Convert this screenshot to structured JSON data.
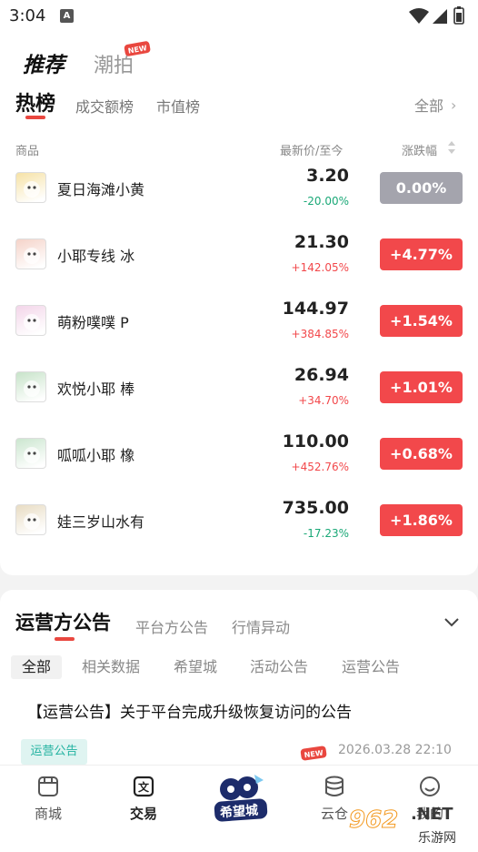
{
  "status_bar": {
    "time": "3:04",
    "notification_icon": "A"
  },
  "top_tabs": {
    "recommend": "推荐",
    "trend": "潮拍",
    "new_badge": "NEW"
  },
  "sub_tabs": {
    "hot": "热榜",
    "volume": "成交额榜",
    "market_cap": "市值榜",
    "all": "全部",
    "all_chevron": "›"
  },
  "columns": {
    "goods": "商品",
    "price": "最新价/至今",
    "change": "涨跌幅"
  },
  "colors": {
    "up": "#f2484b",
    "down": "#1aa877",
    "flat": "#a4a4ad",
    "accent": "#e9473f"
  },
  "rows": [
    {
      "name": "夏日海滩小黄",
      "price": "3.20",
      "rel": "-20.00%",
      "rel_dir": "down",
      "change": "0.00%",
      "change_dir": "flat",
      "thumb_color": "#f6e2a6"
    },
    {
      "name": "小耶专线 冰",
      "price": "21.30",
      "rel": "+142.05%",
      "rel_dir": "up",
      "change": "+4.77%",
      "change_dir": "up",
      "thumb_color": "#f5d3c9"
    },
    {
      "name": "萌粉噗噗 P",
      "price": "144.97",
      "rel": "+384.85%",
      "rel_dir": "up",
      "change": "+1.54%",
      "change_dir": "up",
      "thumb_color": "#f3d5e9"
    },
    {
      "name": "欢悦小耶 棒",
      "price": "26.94",
      "rel": "+34.70%",
      "rel_dir": "up",
      "change": "+1.01%",
      "change_dir": "up",
      "thumb_color": "#c7e3c9"
    },
    {
      "name": "呱呱小耶 橡",
      "price": "110.00",
      "rel": "+452.76%",
      "rel_dir": "up",
      "change": "+0.68%",
      "change_dir": "up",
      "thumb_color": "#cbe6cf"
    },
    {
      "name": "娃三岁山水有",
      "price": "735.00",
      "rel": "-17.23%",
      "rel_dir": "down",
      "change": "+1.86%",
      "change_dir": "up",
      "thumb_color": "#e8dcc3"
    }
  ],
  "announcements": {
    "title": "运营方公告",
    "tab_platform": "平台方公告",
    "tab_market": "行情异动",
    "filters": [
      "全部",
      "相关数据",
      "希望城",
      "活动公告",
      "运营公告"
    ],
    "headline": "【运营公告】关于平台完成升级恢复访问的公告",
    "tag": "运营公告",
    "new_badge": "NEW",
    "date": "2026.03.28 22:10"
  },
  "bottom_nav": {
    "items": [
      {
        "label": "商城",
        "icon": "shop-icon"
      },
      {
        "label": "交易",
        "icon": "trade-icon",
        "active": true
      },
      {
        "label": "希望城",
        "icon": "hope-city-logo"
      },
      {
        "label": "云仓",
        "icon": "warehouse-icon"
      },
      {
        "label": "我的",
        "icon": "profile-icon"
      }
    ]
  },
  "watermark": {
    "number": "962",
    "url": ".NET",
    "sub": "乐游网"
  }
}
